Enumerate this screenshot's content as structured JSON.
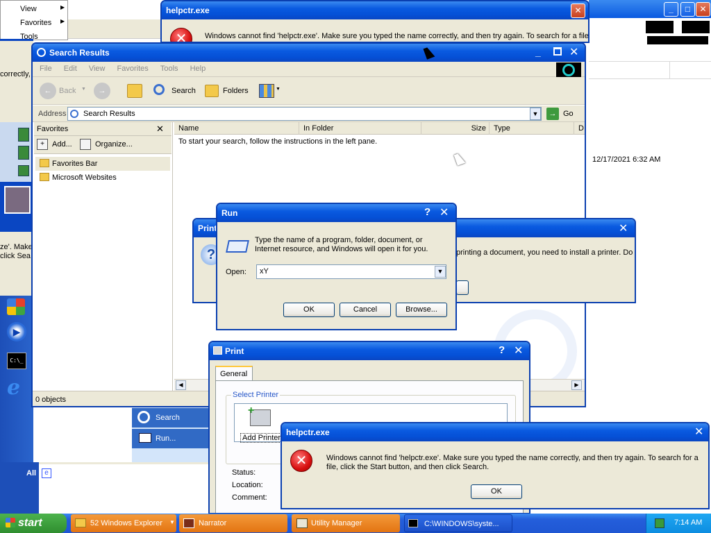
{
  "bg_menu": {
    "items": [
      "View",
      "Favorites",
      "Tools"
    ]
  },
  "error_top": {
    "title": "helpctr.exe",
    "message": "Windows cannot find 'helpctr.exe'. Make sure you typed the name correctly, and then try again. To search for a file,"
  },
  "left_fragments": {
    "a": "correctly,",
    "b": "ze'. Make",
    "c": "click Sea"
  },
  "search_results": {
    "title": "Search Results",
    "menu": [
      "File",
      "Edit",
      "View",
      "Favorites",
      "Tools",
      "Help"
    ],
    "toolbar": {
      "back": "Back",
      "search": "Search",
      "folders": "Folders"
    },
    "address_label": "Address",
    "address_value": "Search Results",
    "go": "Go",
    "favorites": {
      "title": "Favorites",
      "add": "Add...",
      "organize": "Organize...",
      "items": [
        "Favorites Bar",
        "Microsoft Websites"
      ]
    },
    "columns": [
      "Name",
      "In Folder",
      "Size",
      "Type",
      "D"
    ],
    "empty_message": "To start your search, follow the instructions in the left pane.",
    "status": "0 objects"
  },
  "timestamp": "12/17/2021 6:32 AM",
  "printer_msg": {
    "title": "Print",
    "message_line1": "printing a document, you need to install a printer. Do"
  },
  "run_dialog": {
    "title": "Run",
    "description": "Type the name of a program, folder, document, or Internet resource, and Windows will open it for you.",
    "open_label": "Open:",
    "open_value": "xY",
    "ok": "OK",
    "cancel": "Cancel",
    "browse": "Browse..."
  },
  "print_dialog": {
    "title": "Print",
    "tab": "General",
    "group_label": "Select Printer",
    "add_printer": "Add Printer",
    "status_label": "Status:",
    "location_label": "Location:",
    "comment_label": "Comment:"
  },
  "start_menu": {
    "search": "Search",
    "run": "Run...",
    "all": "All"
  },
  "error_bottom": {
    "title": "helpctr.exe",
    "message": "Windows cannot find 'helpctr.exe'. Make sure you typed the name correctly, and then try again. To search for a file, click the Start button, and then click Search.",
    "ok": "OK"
  },
  "taskbar": {
    "start": "start",
    "tasks": [
      "52 Windows Explorer",
      "Narrator",
      "Utility Manager",
      "C:\\WINDOWS\\syste..."
    ],
    "clock": "7:14 AM"
  }
}
